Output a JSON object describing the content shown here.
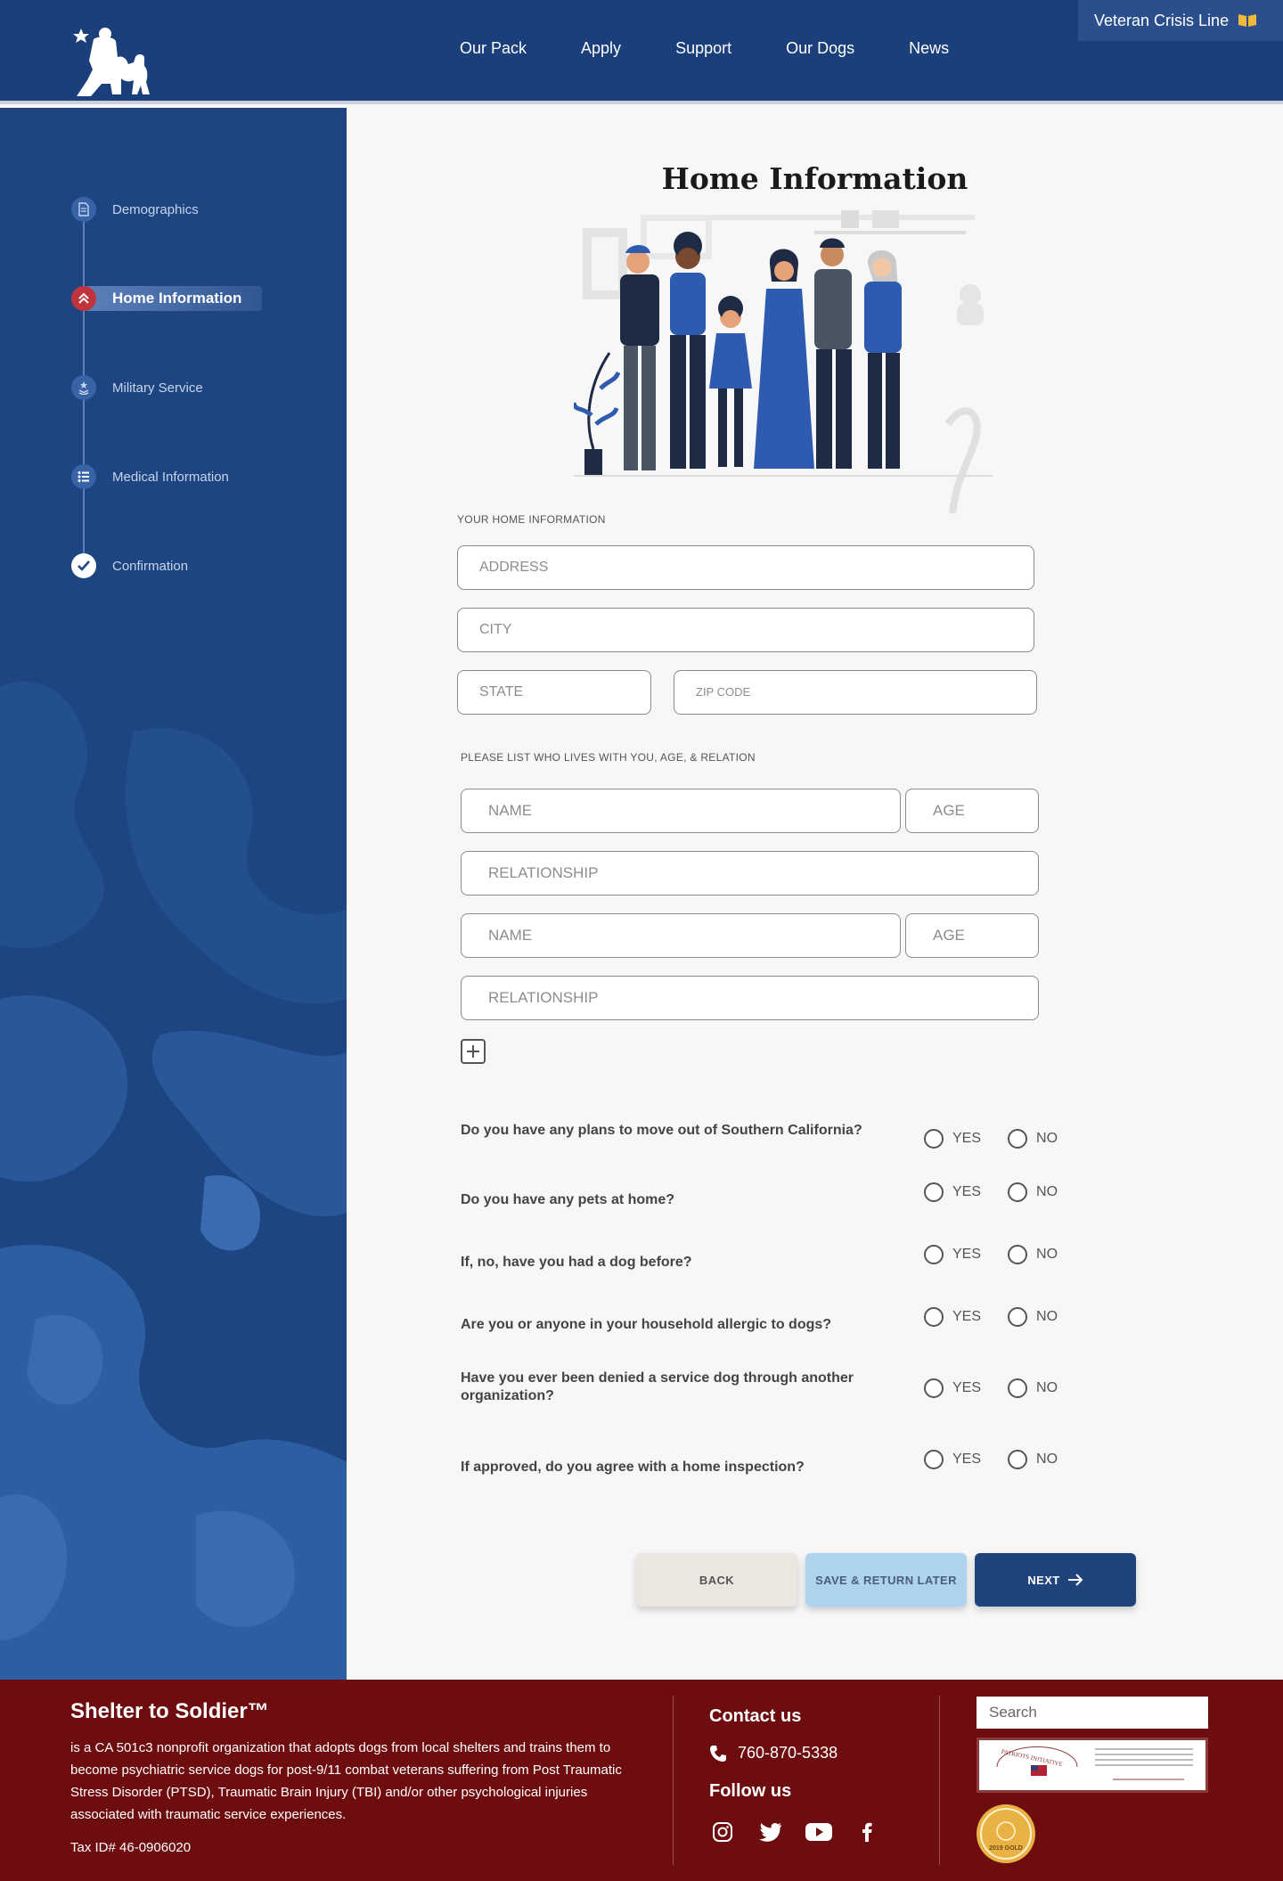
{
  "header": {
    "nav": [
      "Our Pack",
      "Apply",
      "Support",
      "Our Dogs",
      "News"
    ],
    "crisis_line": "Veteran Crisis Line"
  },
  "sidebar": {
    "steps": [
      {
        "label": "Demographics",
        "icon": "document-icon",
        "state": "default"
      },
      {
        "label": "Home Information",
        "icon": "home-chevron-icon",
        "state": "active"
      },
      {
        "label": "Military Service",
        "icon": "medal-icon",
        "state": "default"
      },
      {
        "label": "Medical Information",
        "icon": "list-icon",
        "state": "default"
      },
      {
        "label": "Confirmation",
        "icon": "check-icon",
        "state": "done"
      }
    ]
  },
  "main": {
    "title": "Home Information",
    "home_section_label": "YOUR HOME INFORMATION",
    "address_placeholder": "ADDRESS",
    "city_placeholder": "CITY",
    "state_placeholder": "STATE",
    "zip_placeholder": "ZIP CODE",
    "household_label": "PLEASE LIST WHO LIVES WITH YOU, AGE, & RELATION",
    "name_placeholder": "NAME",
    "age_placeholder": "AGE",
    "relationship_placeholder": "RELATIONSHIP",
    "yes_label": "YES",
    "no_label": "NO",
    "questions": [
      "Do you have any plans to move out of Southern California?",
      "Do you have any pets at home?",
      "If, no, have you had a dog before?",
      "Are you or anyone in your household allergic to dogs?",
      "Have you ever been denied a service dog through another organization?",
      "If approved, do you agree with a home inspection?"
    ],
    "back_label": "BACK",
    "save_label": "SAVE & RETURN LATER",
    "next_label": "NEXT"
  },
  "footer": {
    "org_name": "Shelter to Soldier™",
    "description": " is a CA 501c3 nonprofit organization that adopts dogs from local shelters and trains them to become psychiatric service dogs for post-9/11 combat veterans suffering from Post Traumatic Stress Disorder (PTSD), Traumatic Brain Injury (TBI) and/or other psychological injuries associated with traumatic service experiences.",
    "tax_id": "Tax ID# 46-0906020",
    "contact_heading": "Contact us",
    "phone": "760-870-5338",
    "follow_heading": "Follow us",
    "search_placeholder": "Search",
    "badge_patriots": "PATRIOTS INITIATIVE",
    "badge_guidestar": "2019 GOLD"
  },
  "colors": {
    "header_bg": "#1b3f7a",
    "sidebar_bg": "#1c4582",
    "active_step": "#c0353d",
    "next_button": "#1f437d",
    "save_button": "#aed3ef",
    "back_button": "#ebe6e0",
    "footer_bg": "#6e0d10"
  }
}
